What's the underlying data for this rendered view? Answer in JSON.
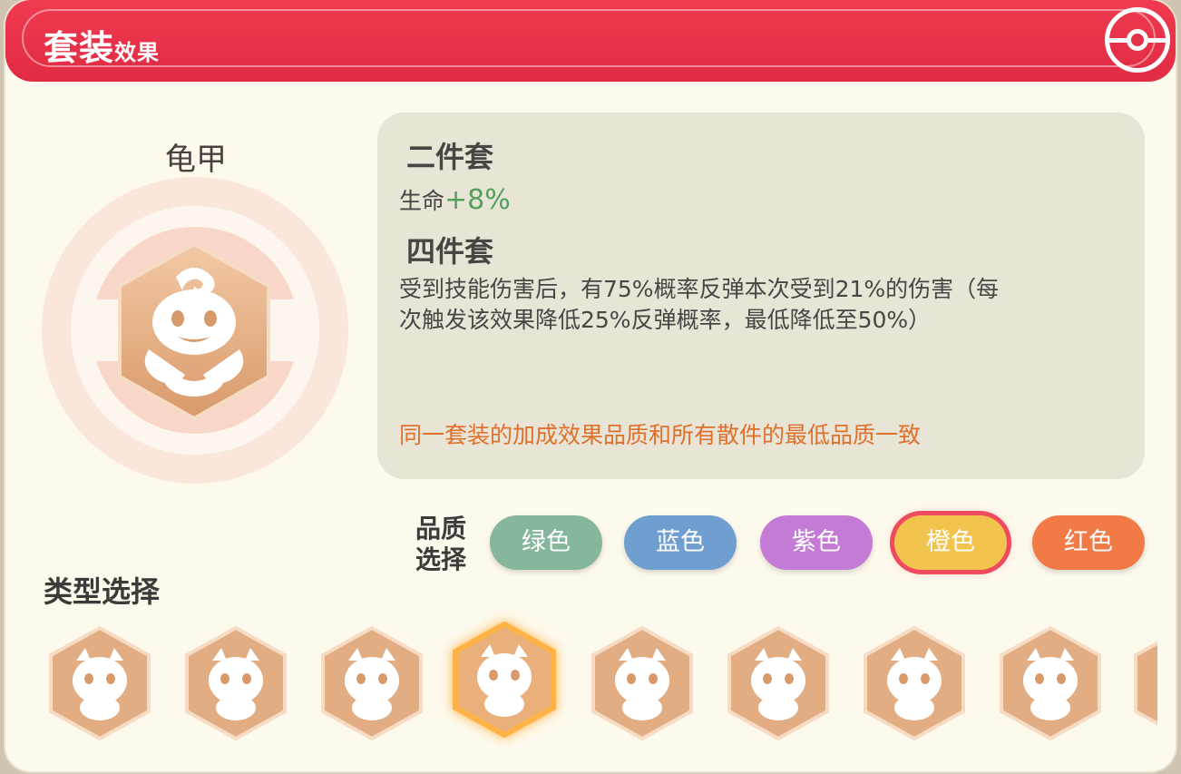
{
  "header": {
    "title_big": "套装",
    "title_small": "效果"
  },
  "set": {
    "name": "龟甲",
    "emblem": "shell-emblem-icon"
  },
  "effects": {
    "two_piece_title": "二件套",
    "two_piece_stat": "生命",
    "two_piece_value": "+8%",
    "four_piece_title": "四件套",
    "four_piece_line1": "受到技能伤害后，有75%概率反弹本次受到21%的伤害（每",
    "four_piece_line2": "次触发该效果降低25%反弹概率，最低降低至50%）",
    "note": "同一套装的加成效果品质和所有散件的最低品质一致"
  },
  "quality": {
    "label_line1": "品质",
    "label_line2": "选择",
    "options": [
      {
        "label": "绿色",
        "color": "#86b69b"
      },
      {
        "label": "蓝色",
        "color": "#6e9fd0"
      },
      {
        "label": "紫色",
        "color": "#c47bd6"
      },
      {
        "label": "橙色",
        "color": "#f2c44e",
        "selected": true
      },
      {
        "label": "红色",
        "color": "#f27a47"
      }
    ]
  },
  "type": {
    "label": "类型选择",
    "items": [
      {
        "icon": "dragon-emblem-icon"
      },
      {
        "icon": "horned-emblem-icon"
      },
      {
        "icon": "beast-emblem-icon"
      },
      {
        "icon": "shell-emblem-icon",
        "selected": true
      },
      {
        "icon": "brute-emblem-icon"
      },
      {
        "icon": "bull-emblem-icon"
      },
      {
        "icon": "crest-emblem-icon"
      },
      {
        "icon": "ghost-emblem-icon"
      },
      {
        "icon": "partial-emblem-icon"
      }
    ]
  },
  "colors": {
    "header_red": "#e8304a",
    "panel_bg": "#fdf9ec",
    "emblem_orange": "#e2a877",
    "note_orange": "#e0702c",
    "stat_green": "#53a05e"
  }
}
